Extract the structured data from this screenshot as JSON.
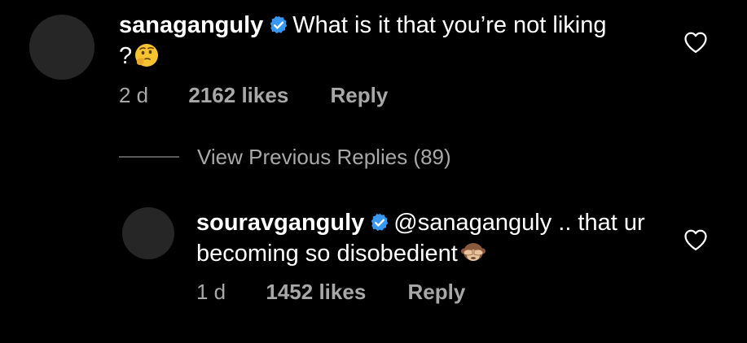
{
  "comments": [
    {
      "username": "sanaganguly",
      "text": "What is it that you’re not liking ?",
      "emoji": "thinking-face",
      "age": "2 d",
      "likes": "2162 likes",
      "reply_label": "Reply",
      "verified": true
    },
    {
      "username": "souravganguly",
      "mention": "@sanaganguly",
      "text": " .. that ur becoming so disobedient",
      "emoji": "see-no-evil-monkey",
      "age": "1 d",
      "likes": "1452 likes",
      "reply_label": "Reply",
      "verified": true
    }
  ],
  "view_previous": "View Previous Replies (89)",
  "colors": {
    "background": "#000000",
    "text": "#ffffff",
    "secondary": "#a8a8a8",
    "verified": "#3897f0"
  }
}
